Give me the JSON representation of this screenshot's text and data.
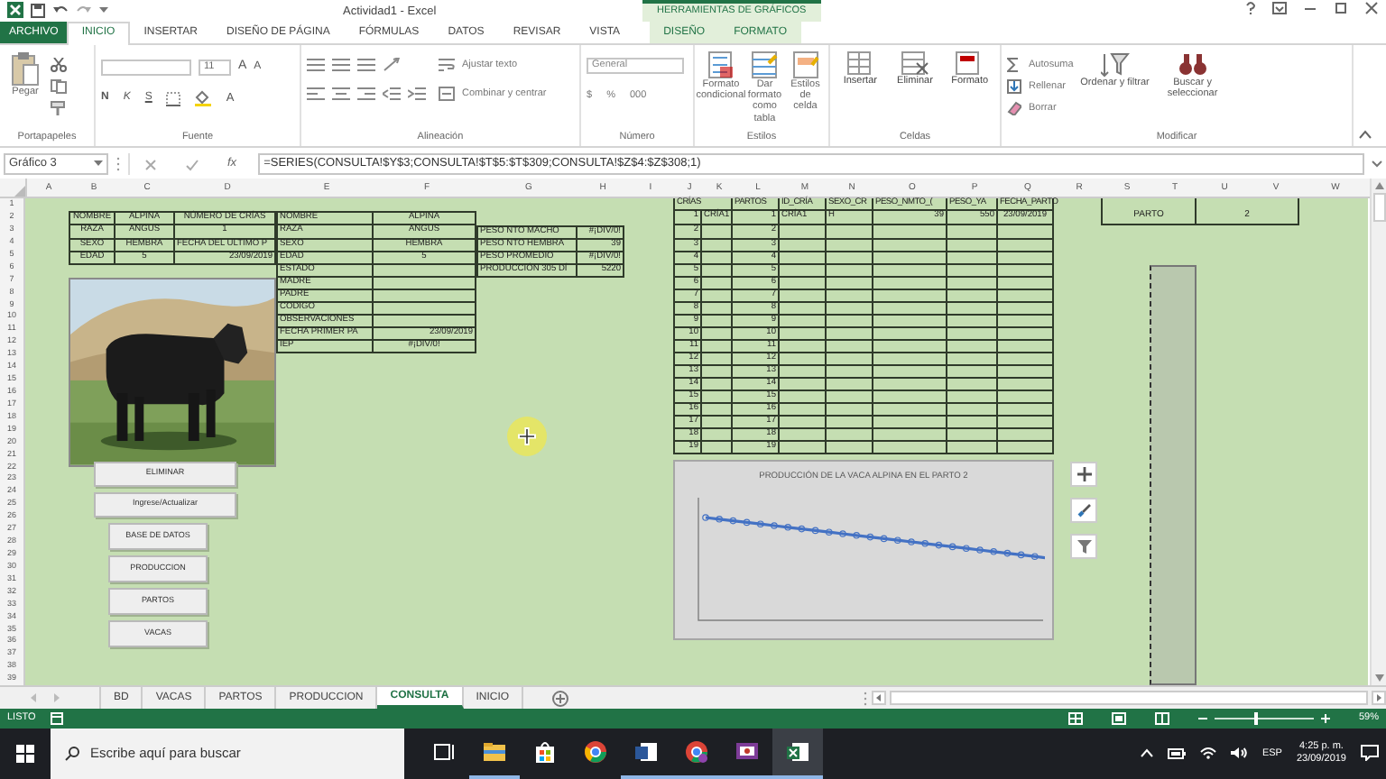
{
  "title_bar": {
    "title": "Actividad1 - Excel",
    "context_label": "HERRAMIENTAS DE GRÁFICOS"
  },
  "tabs": [
    {
      "label": "ARCHIVO",
      "kind": "file",
      "selected": false
    },
    {
      "label": "INICIO",
      "kind": "main",
      "selected": true
    },
    {
      "label": "INSERTAR",
      "kind": "main",
      "selected": false
    },
    {
      "label": "DISEÑO DE PÁGINA",
      "kind": "main",
      "selected": false
    },
    {
      "label": "FÓRMULAS",
      "kind": "main",
      "selected": false
    },
    {
      "label": "DATOS",
      "kind": "main",
      "selected": false
    },
    {
      "label": "REVISAR",
      "kind": "main",
      "selected": false
    },
    {
      "label": "VISTA",
      "kind": "main",
      "selected": false
    },
    {
      "label": "DISEÑO",
      "kind": "context",
      "selected": false
    },
    {
      "label": "FORMATO",
      "kind": "context",
      "selected": false
    }
  ],
  "ribbon": {
    "groups": [
      {
        "label": "Portapapeles",
        "buttons": [
          "Pegar"
        ]
      },
      {
        "label": "Fuente",
        "font_size": "11",
        "size_buttons": [
          "A",
          "A"
        ],
        "style_buttons": [
          "N",
          "K",
          "S"
        ],
        "color_button": "A"
      },
      {
        "label": "Alineación",
        "buttons": [
          "Ajustar texto",
          "Combinar y centrar"
        ]
      },
      {
        "label": "Número",
        "format": "General",
        "buttons": [
          "$",
          "%",
          "000"
        ]
      },
      {
        "label": "Estilos",
        "buttons": [
          "Formato condicional",
          "Dar formato como tabla",
          "Estilos de celda"
        ]
      },
      {
        "label": "Celdas",
        "buttons": [
          "Insertar",
          "Eliminar",
          "Formato"
        ]
      },
      {
        "label": "Modificar",
        "buttons": [
          "Autosuma",
          "Rellenar",
          "Borrar",
          "Ordenar y filtrar",
          "Buscar y seleccionar"
        ]
      }
    ]
  },
  "formula_bar": {
    "name_box": "Gráfico 3",
    "fx": "fx",
    "formula": "=SERIES(CONSULTA!$Y$3;CONSULTA!$T$5:$T$309;CONSULTA!$Z$4:$Z$308;1)"
  },
  "sheet": {
    "columns": [
      "A",
      "B",
      "C",
      "D",
      "E",
      "F",
      "G",
      "H",
      "I",
      "J",
      "K",
      "L",
      "M",
      "N",
      "O",
      "P",
      "Q",
      "R",
      "S",
      "T",
      "U",
      "V",
      "W"
    ],
    "rows": [
      "1",
      "2",
      "3",
      "4",
      "5",
      "6",
      "7",
      "8",
      "9",
      "10",
      "11",
      "12",
      "13",
      "14",
      "15",
      "16",
      "17",
      "18",
      "19",
      "20",
      "21",
      "22",
      "23",
      "24",
      "25",
      "26",
      "27",
      "28",
      "29",
      "30",
      "31",
      "32",
      "33",
      "34",
      "35",
      "36",
      "37",
      "38",
      "39"
    ],
    "summary_table": [
      [
        "NOMBRE",
        "ALPINA",
        "NÚMERO DE CRÍAS"
      ],
      [
        "RAZA",
        "ANGUS",
        "1"
      ],
      [
        "SEXO",
        "HEMBRA",
        "FECHA DEL ULTIMO P"
      ],
      [
        "EDAD",
        "5",
        "23/09/2019"
      ]
    ],
    "detail_table": [
      [
        "NOMBRE",
        "ALPINA"
      ],
      [
        "RAZA",
        "ANGUS"
      ],
      [
        "SEXO",
        "HEMBRA"
      ],
      [
        "EDAD",
        "5"
      ],
      [
        "ESTADO"
      ],
      [
        "MADRE"
      ],
      [
        "PADRE"
      ],
      [
        "CODIGO"
      ],
      [
        "OBSERVACIONES"
      ],
      [
        "FECHA PRIMER PA",
        "23/09/2019"
      ],
      [
        "IEP",
        "#¡DIV/0!"
      ]
    ],
    "weights_table": [
      [
        "PESO NTO MACHO",
        "#¡DIV/0!"
      ],
      [
        "PESO NTO HEMBRA",
        "39"
      ],
      [
        "PESO PROMEDIO",
        "#¡DIV/0!"
      ],
      [
        "PRODUCCIÓN 305 DÍ",
        "5220"
      ]
    ],
    "births_table": {
      "columns": [
        "CRÍAS",
        null,
        "PARTOS",
        "ID_CRÍA",
        "SEXO_CR",
        "PESO_NMTO_(",
        "PESO_YA",
        "FECHA_PARTO"
      ],
      "rows": [
        [
          "1",
          "CRÍA1",
          "1",
          "CRÍA1",
          "H",
          "39",
          "550",
          "23/09/2019"
        ],
        [
          "2",
          null,
          "2",
          null,
          null,
          null,
          null,
          null
        ],
        [
          "3",
          null,
          "3",
          null,
          null,
          null,
          null,
          null
        ],
        [
          "4",
          null,
          "4",
          null,
          null,
          null,
          null,
          null
        ],
        [
          "5",
          null,
          "5",
          null,
          null,
          null,
          null,
          null
        ],
        [
          "6",
          null,
          "6",
          null,
          null,
          null,
          null,
          null
        ],
        [
          "7",
          null,
          "7",
          null,
          null,
          null,
          null,
          null
        ],
        [
          "8",
          null,
          "8",
          null,
          null,
          null,
          null,
          null
        ],
        [
          "9",
          null,
          "9",
          null,
          null,
          null,
          null,
          null
        ],
        [
          "10",
          null,
          "10",
          null,
          null,
          null,
          null,
          null
        ],
        [
          "11",
          null,
          "11",
          null,
          null,
          null,
          null,
          null
        ],
        [
          "12",
          null,
          "12",
          null,
          null,
          null,
          null,
          null
        ],
        [
          "13",
          null,
          "13",
          null,
          null,
          null,
          null,
          null
        ],
        [
          "14",
          null,
          "14",
          null,
          null,
          null,
          null,
          null
        ],
        [
          "15",
          null,
          "15",
          null,
          null,
          null,
          null,
          null
        ],
        [
          "16",
          null,
          "16",
          null,
          null,
          null,
          null,
          null
        ],
        [
          "17",
          null,
          "17",
          null,
          null,
          null,
          null,
          null
        ],
        [
          "18",
          null,
          "18",
          null,
          null,
          null,
          null,
          null
        ],
        [
          "19",
          null,
          "19",
          null,
          null,
          null,
          null,
          null
        ]
      ]
    },
    "parto": {
      "label": "PARTO",
      "value": "2"
    },
    "macro_buttons": [
      {
        "label": "ELIMINAR",
        "kind": "wide"
      },
      {
        "label": "Ingrese/Actualizar",
        "kind": "wide"
      },
      {
        "label": "BASE DE DATOS",
        "kind": "narrow"
      },
      {
        "label": "PRODUCCION",
        "kind": "narrow"
      },
      {
        "label": "PARTOS",
        "kind": "narrow"
      },
      {
        "label": "VACAS",
        "kind": "narrow"
      }
    ],
    "chart": {
      "title": "PRODUCCIÓN DE LA VACA ALPINA EN EL PARTO 2"
    }
  },
  "sheet_tabs": [
    {
      "label": "BD",
      "selected": false
    },
    {
      "label": "VACAS",
      "selected": false
    },
    {
      "label": "PARTOS",
      "selected": false
    },
    {
      "label": "PRODUCCION",
      "selected": false
    },
    {
      "label": "CONSULTA",
      "selected": true
    },
    {
      "label": "INICIO",
      "selected": false
    }
  ],
  "status_bar": {
    "mode": "LISTO",
    "zoom": "59%",
    "level": 0.4
  },
  "taskbar": {
    "search_placeholder": "Escribe aquí para buscar",
    "apps": [
      {
        "running": false,
        "selected": false
      },
      {
        "running": true,
        "selected": false
      },
      {
        "running": false,
        "selected": false
      },
      {
        "running": false,
        "selected": false
      },
      {
        "running": true,
        "selected": false
      },
      {
        "running": true,
        "selected": false
      },
      {
        "running": true,
        "selected": false
      },
      {
        "running": true,
        "selected": true
      }
    ],
    "language": "ESP",
    "time": "4:25 p. m.",
    "date": "23/09/2019"
  }
}
